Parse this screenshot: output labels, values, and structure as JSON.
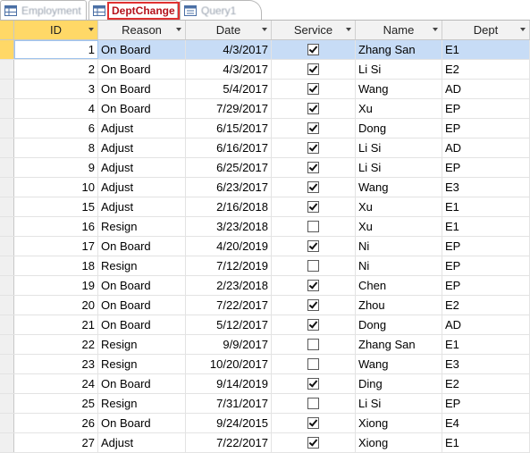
{
  "tabs": [
    {
      "label": "Employment",
      "active": false
    },
    {
      "label": "DeptChange",
      "active": true
    },
    {
      "label": "Query1",
      "active": false
    }
  ],
  "columns": [
    "ID",
    "Reason",
    "Date",
    "Service",
    "Name",
    "Dept"
  ],
  "rows": [
    {
      "id": "1",
      "reason": "On Board",
      "date": "4/3/2017",
      "service": true,
      "name": "Zhang San",
      "dept": "E1"
    },
    {
      "id": "2",
      "reason": "On Board",
      "date": "4/3/2017",
      "service": true,
      "name": "Li Si",
      "dept": "E2"
    },
    {
      "id": "3",
      "reason": "On Board",
      "date": "5/4/2017",
      "service": true,
      "name": "Wang",
      "dept": "AD"
    },
    {
      "id": "4",
      "reason": "On Board",
      "date": "7/29/2017",
      "service": true,
      "name": "Xu",
      "dept": "EP"
    },
    {
      "id": "6",
      "reason": "Adjust",
      "date": "6/15/2017",
      "service": true,
      "name": "Dong",
      "dept": "EP"
    },
    {
      "id": "8",
      "reason": "Adjust",
      "date": "6/16/2017",
      "service": true,
      "name": "Li Si",
      "dept": "AD"
    },
    {
      "id": "9",
      "reason": "Adjust",
      "date": "6/25/2017",
      "service": true,
      "name": "Li Si",
      "dept": "EP"
    },
    {
      "id": "10",
      "reason": "Adjust",
      "date": "6/23/2017",
      "service": true,
      "name": "Wang",
      "dept": "E3"
    },
    {
      "id": "15",
      "reason": "Adjust",
      "date": "2/16/2018",
      "service": true,
      "name": "Xu",
      "dept": "E1"
    },
    {
      "id": "16",
      "reason": "Resign",
      "date": "3/23/2018",
      "service": false,
      "name": "Xu",
      "dept": "E1"
    },
    {
      "id": "17",
      "reason": "On Board",
      "date": "4/20/2019",
      "service": true,
      "name": "Ni",
      "dept": "EP"
    },
    {
      "id": "18",
      "reason": "Resign",
      "date": "7/12/2019",
      "service": false,
      "name": "Ni",
      "dept": "EP"
    },
    {
      "id": "19",
      "reason": "On Board",
      "date": "2/23/2018",
      "service": true,
      "name": "Chen",
      "dept": "EP"
    },
    {
      "id": "20",
      "reason": "On Board",
      "date": "7/22/2017",
      "service": true,
      "name": "Zhou",
      "dept": "E2"
    },
    {
      "id": "21",
      "reason": "On Board",
      "date": "5/12/2017",
      "service": true,
      "name": "Dong",
      "dept": "AD"
    },
    {
      "id": "22",
      "reason": "Resign",
      "date": "9/9/2017",
      "service": false,
      "name": "Zhang San",
      "dept": "E1"
    },
    {
      "id": "23",
      "reason": "Resign",
      "date": "10/20/2017",
      "service": false,
      "name": "Wang",
      "dept": "E3"
    },
    {
      "id": "24",
      "reason": "On Board",
      "date": "9/14/2019",
      "service": true,
      "name": "Ding",
      "dept": "E2"
    },
    {
      "id": "25",
      "reason": "Resign",
      "date": "7/31/2017",
      "service": false,
      "name": "Li Si",
      "dept": "EP"
    },
    {
      "id": "26",
      "reason": "On Board",
      "date": "9/24/2015",
      "service": true,
      "name": "Xiong",
      "dept": "E4"
    },
    {
      "id": "27",
      "reason": "Adjust",
      "date": "7/22/2017",
      "service": true,
      "name": "Xiong",
      "dept": "E1"
    }
  ],
  "colors": {
    "selected_row": "#c7dcf6",
    "active_header": "#ffd867",
    "active_tab_label": "#b5121b"
  }
}
